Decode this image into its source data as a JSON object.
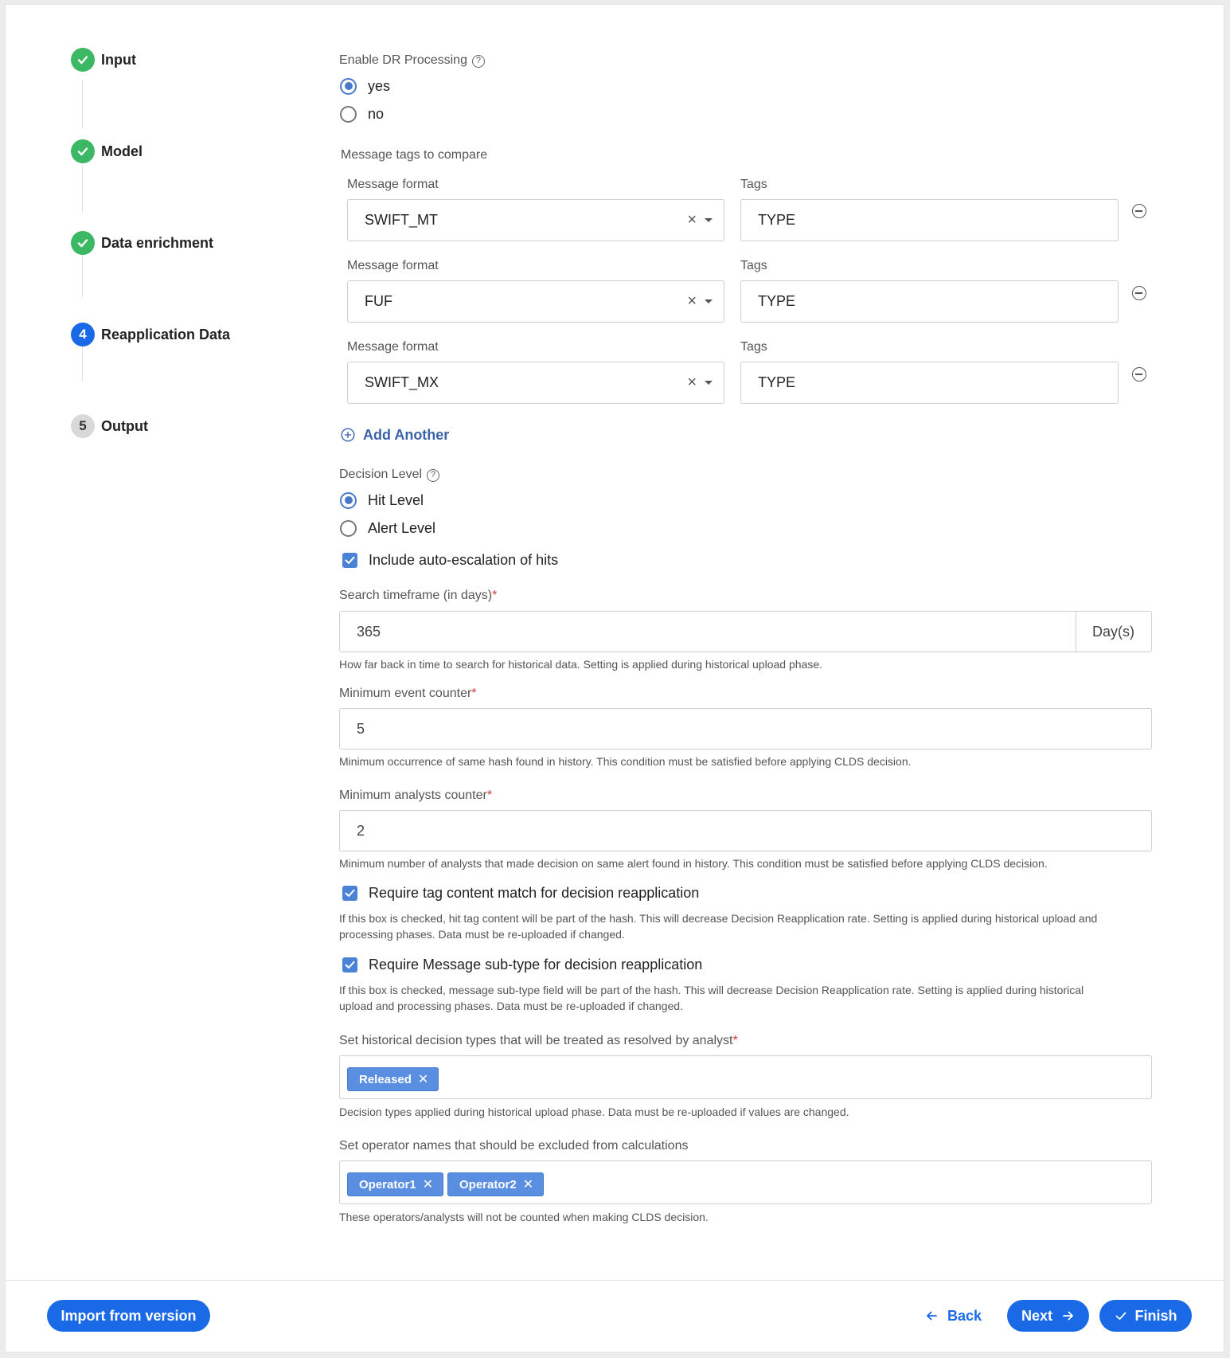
{
  "stepper": {
    "steps": [
      {
        "label": "Input",
        "status": "done",
        "number": ""
      },
      {
        "label": "Model",
        "status": "done",
        "number": ""
      },
      {
        "label": "Data enrichment",
        "status": "done",
        "number": ""
      },
      {
        "label": "Reapplication Data",
        "status": "current",
        "number": "4"
      },
      {
        "label": "Output",
        "status": "todo",
        "number": "5"
      }
    ]
  },
  "dr_processing": {
    "label": "Enable DR Processing",
    "options": [
      {
        "label": "yes",
        "selected": true
      },
      {
        "label": "no",
        "selected": false
      }
    ]
  },
  "message_tags": {
    "section_label": "Message tags to compare",
    "format_label": "Message format",
    "tags_label": "Tags",
    "rows": [
      {
        "format": "SWIFT_MT",
        "tags": "TYPE"
      },
      {
        "format": "FUF",
        "tags": "TYPE"
      },
      {
        "format": "SWIFT_MX",
        "tags": "TYPE"
      }
    ],
    "add_label": "Add Another"
  },
  "decision_level": {
    "label": "Decision Level",
    "options": [
      {
        "label": "Hit Level",
        "selected": true
      },
      {
        "label": "Alert Level",
        "selected": false
      }
    ],
    "auto_escalation": {
      "label": "Include auto-escalation of hits",
      "checked": true
    }
  },
  "search_timeframe": {
    "label": "Search timeframe (in days)",
    "required": "*",
    "value": "365",
    "suffix": "Day(s)",
    "help": "How far back in time to search for historical data. Setting is applied during historical upload phase."
  },
  "min_event_counter": {
    "label": "Minimum event counter",
    "required": "*",
    "value": "5",
    "help": "Minimum occurrence of same hash found in history. This condition must be satisfied before applying CLDS decision."
  },
  "min_analysts_counter": {
    "label": "Minimum analysts counter",
    "required": "*",
    "value": "2",
    "help": "Minimum number of analysts that made decision on same alert found in history. This condition must be satisfied before applying CLDS decision."
  },
  "tag_content_match": {
    "label": "Require tag content match for decision reapplication",
    "checked": true,
    "help_line1": "If this box is checked, hit tag content will be part of the hash. This will decrease Decision Reapplication rate. Setting is applied during historical upload and",
    "help_line2": "processing phases. Data must be re-uploaded if changed."
  },
  "message_subtype": {
    "label": "Require Message sub-type for decision reapplication",
    "checked": true,
    "help_line1": "If this box is checked, message sub-type field will be part of the hash. This will decrease Decision Reapplication rate. Setting is applied during historical",
    "help_line2": "upload and processing phases. Data must be re-uploaded if changed."
  },
  "decision_types": {
    "label": "Set historical decision types that will be treated as resolved by analyst",
    "required": "*",
    "chips": [
      "Released"
    ],
    "help": "Decision types applied during historical upload phase. Data must be re-uploaded if values are changed."
  },
  "excluded_operators": {
    "label": "Set operator names that should be excluded from calculations",
    "chips": [
      "Operator1",
      "Operator2"
    ],
    "help": "These operators/analysts will not be counted when making CLDS decision."
  },
  "footer": {
    "import_label": "Import from version",
    "back_label": "Back",
    "next_label": "Next",
    "finish_label": "Finish"
  },
  "colors": {
    "primary": "#1a6ae8",
    "done_green": "#3cb864",
    "chip_blue": "#5a8ee0",
    "required_red": "#d93838"
  }
}
